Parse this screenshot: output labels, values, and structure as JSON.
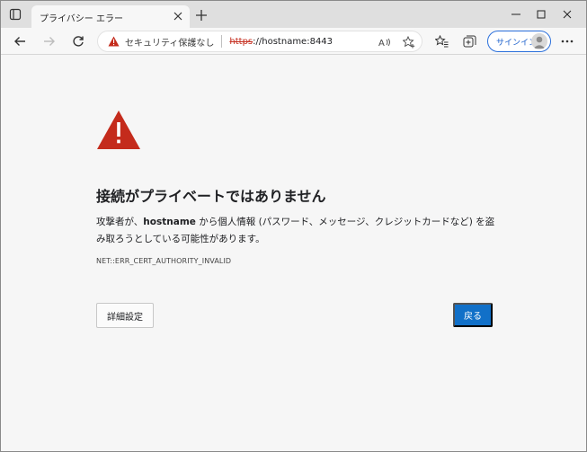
{
  "tab": {
    "title": "プライバシー エラー"
  },
  "window_controls": [
    "minimize",
    "maximize",
    "close"
  ],
  "address_bar": {
    "security_label": "セキュリティ保護なし",
    "url_scheme": "https",
    "url_rest": "://hostname:8443"
  },
  "toolbar": {
    "signin_label": "サインイン"
  },
  "error_page": {
    "headline": "接続がプライベートではありません",
    "desc_prefix": "攻撃者が、",
    "desc_host": "hostname",
    "desc_suffix": " から個人情報 (パスワード、メッセージ、クレジットカードなど) を盗み取ろうとしている可能性があります。",
    "error_code": "NET::ERR_CERT_AUTHORITY_INVALID",
    "advanced_button": "詳細設定",
    "back_button": "戻る"
  },
  "colors": {
    "warning_red": "#c42b1c",
    "primary_blue": "#1170c8",
    "page_background": "#f6f6f6"
  },
  "icons": [
    "tab-actions-icon",
    "close-icon",
    "plus-icon",
    "minimize-icon",
    "maximize-icon",
    "window-close-icon",
    "back-arrow-icon",
    "forward-arrow-icon",
    "refresh-icon",
    "warning-triangle-icon",
    "read-aloud-icon",
    "add-favorite-icon",
    "favorites-icon",
    "collections-icon",
    "avatar",
    "more-icon",
    "warning-large-icon"
  ]
}
